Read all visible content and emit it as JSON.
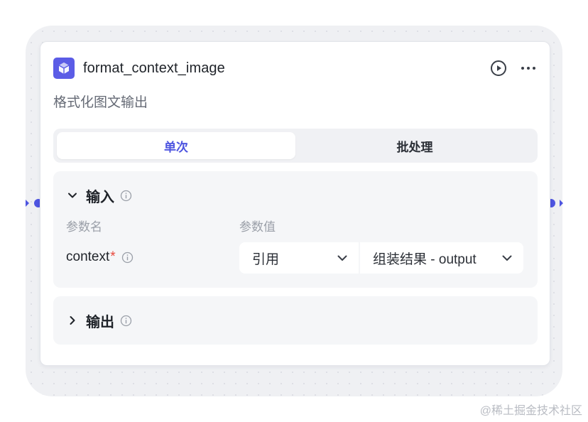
{
  "node": {
    "title": "format_context_image",
    "description": "格式化图文输出",
    "icon": "cube-icon",
    "accent_color": "#5b5ce6"
  },
  "mode_tabs": [
    {
      "label": "单次",
      "active": true
    },
    {
      "label": "批处理",
      "active": false
    }
  ],
  "input_section": {
    "title": "输入",
    "expanded": true,
    "col_name_label": "参数名",
    "col_value_label": "参数值",
    "params": [
      {
        "name": "context",
        "required_mark": "*",
        "type_value": "引用",
        "ref_value": "组装结果 - output"
      }
    ]
  },
  "output_section": {
    "title": "输出",
    "expanded": false
  },
  "watermark": "@稀土掘金技术社区",
  "colors": {
    "port": "#4e55e0",
    "active_tab_text": "#4e55e0",
    "required": "#e8473c"
  }
}
